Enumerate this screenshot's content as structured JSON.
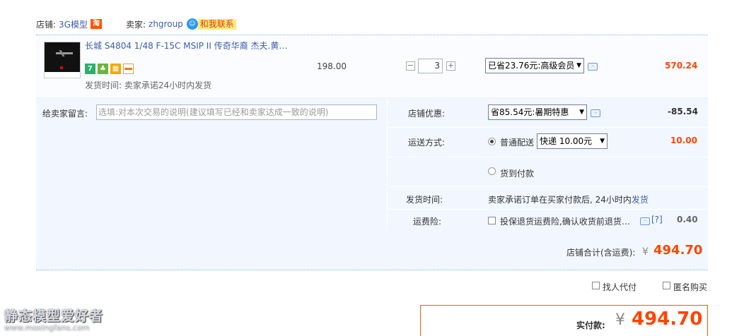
{
  "shop": {
    "shop_label": "店铺:",
    "shop_name": "3G模型",
    "tao_badge": "淘",
    "seller_label": "卖家:",
    "seller_name": "zhgroup",
    "contact_label": "和我联系"
  },
  "item": {
    "title": "长城 S4804 1/48 F-15C MSIP II 传奇华裔 杰夫.黄…",
    "unit_price": "198.00",
    "quantity": "3",
    "discount_option": "已省23.76元:高级会员",
    "total": "570.24",
    "ship_time": "发货时间:  卖家承诺24小时内发货",
    "service_icons": [
      "seven-day-return-icon",
      "seed-icon",
      "grid-icon",
      "card-icon"
    ]
  },
  "options": {
    "message_label": "给卖家留言:",
    "message_placeholder": "选填:对本次交易的说明(建议填写已经和卖家达成一致的说明)",
    "shop_discount_label": "店铺优惠:",
    "shop_discount_option": "省85.54元:暑期特惠",
    "shop_discount_amount": "-85.54",
    "shipping_label": "运送方式:",
    "shipping_normal": "普通配送",
    "shipping_select": "快递 10.00元",
    "shipping_amount": "10.00",
    "cod_label": "货到付款",
    "delivery_time_label": "发货时间:",
    "delivery_time_text": "卖家承诺订单在买家付款后, 24小时内",
    "delivery_time_link": "发货",
    "insurance_label": "运费险:",
    "insurance_text": "投保退货运费险,确认收货前退货…",
    "insurance_help": "[?]",
    "insurance_amount": "0.40"
  },
  "totals": {
    "shop_total_label": "店铺合计(含运费):",
    "currency": "¥",
    "shop_total": "494.70",
    "proxy_pay_label": "找人代付",
    "anonymous_label": "匿名购买",
    "final_label": "实付款:",
    "final_amount": "494.70"
  },
  "watermark": {
    "title": "静态模型爱好者",
    "url": "www.moxingfans.com"
  },
  "colors": {
    "accent": "#ff4400",
    "link": "#3c5fa6",
    "panel": "#f2f7ff"
  }
}
